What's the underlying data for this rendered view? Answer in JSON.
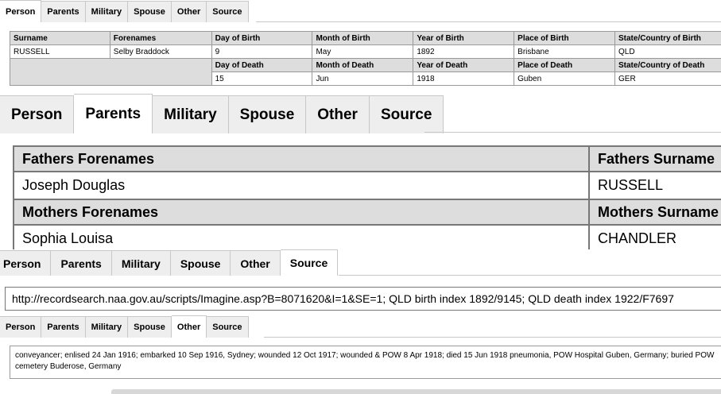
{
  "tabs": [
    "Person",
    "Parents",
    "Military",
    "Spouse",
    "Other",
    "Source"
  ],
  "person": {
    "birth_headers": [
      "Surname",
      "Forenames",
      "Day of Birth",
      "Month of Birth",
      "Year of Birth",
      "Place of Birth",
      "State/Country of Birth"
    ],
    "birth_values": [
      "RUSSELL",
      "Selby Braddock",
      "9",
      "May",
      "1892",
      "Brisbane",
      "QLD"
    ],
    "death_headers": [
      "Day of Death",
      "Month of Death",
      "Year of Death",
      "Place of Death",
      "State/Country of Death"
    ],
    "death_values": [
      "15",
      "Jun",
      "1918",
      "Guben",
      "GER"
    ]
  },
  "parents": {
    "fathers_forenames_label": "Fathers Forenames",
    "fathers_surname_label": "Fathers Surname",
    "fathers_forenames": "Joseph Douglas",
    "fathers_surname": "RUSSELL",
    "mothers_forenames_label": "Mothers Forenames",
    "mothers_surname_label": "Mothers Surname",
    "mothers_forenames": "Sophia Louisa",
    "mothers_surname": "CHANDLER"
  },
  "source": {
    "text": "http://recordsearch.naa.gov.au/scripts/Imagine.asp?B=8071620&I=1&SE=1; QLD birth index 1892/9145; QLD death index 1922/F7697"
  },
  "other": {
    "text": "conveyancer; enlised 24 Jan 1916; embarked 10 Sep 1916, Sydney; wounded 12 Oct 1917; wounded & POW 8 Apr 1918; died 15 Jun 1918 pneumonia, POW Hospital Guben, Germany; buried POW cemetery Buderose, Germany"
  }
}
